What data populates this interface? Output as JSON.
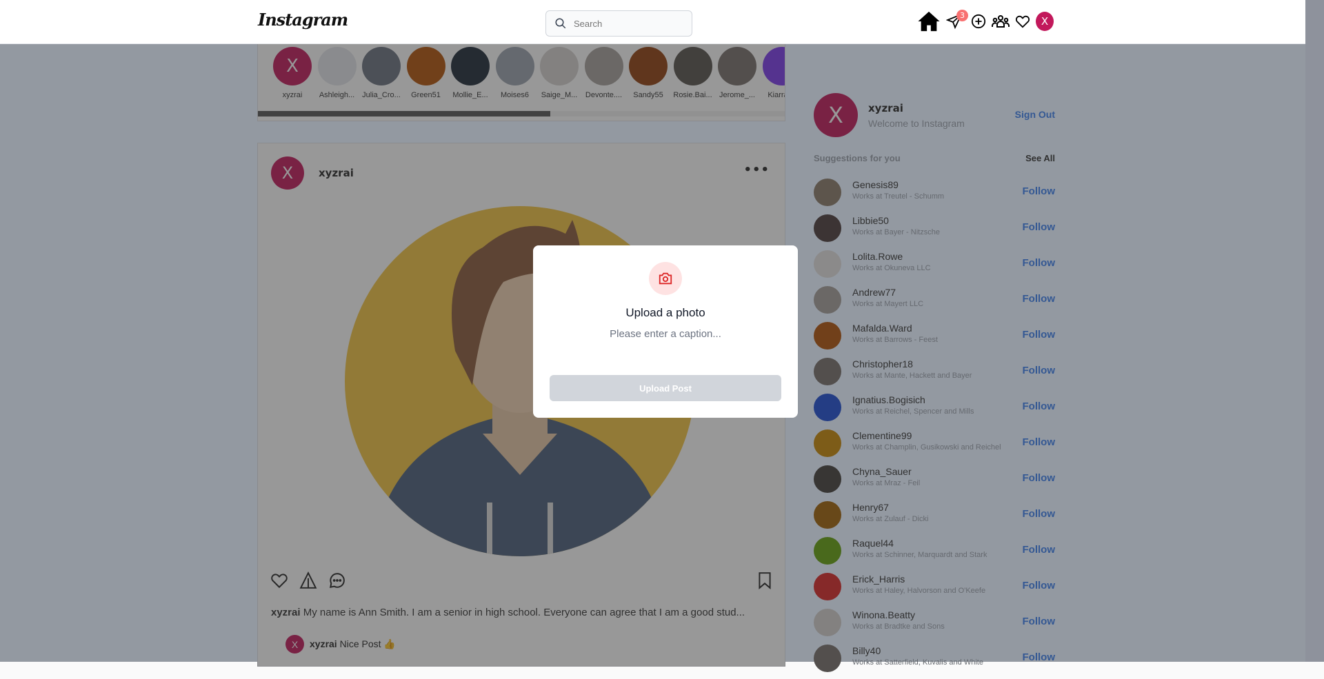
{
  "nav": {
    "logo": "Instagram",
    "search_placeholder": "Search",
    "message_badge": "3",
    "avatar_letter": "X"
  },
  "stories": [
    {
      "name": "xyzrai",
      "letter": "X",
      "color": "#c2185b"
    },
    {
      "name": "Ashleigh...",
      "color": "#e5e7eb"
    },
    {
      "name": "Julia_Cro...",
      "color": "#6b7280"
    },
    {
      "name": "Green51",
      "color": "#b45309"
    },
    {
      "name": "Mollie_E...",
      "color": "#1f2937"
    },
    {
      "name": "Moises6",
      "color": "#9ca3af"
    },
    {
      "name": "Saige_M...",
      "color": "#d6d3d1"
    },
    {
      "name": "Devonte....",
      "color": "#a8a29e"
    },
    {
      "name": "Sandy55",
      "color": "#92400e"
    },
    {
      "name": "Rosie.Bai...",
      "color": "#57534e"
    },
    {
      "name": "Jerome_...",
      "color": "#78716c"
    },
    {
      "name": "Kiarra.C",
      "color": "#7c3aed"
    }
  ],
  "post": {
    "avatar_letter": "X",
    "username": "xyzrai",
    "more": "•••",
    "caption_user": "xyzrai",
    "caption_text": "My name is Ann Smith. I am a senior in high school. Everyone can agree that I am a good stud...",
    "comment": {
      "avatar_letter": "X",
      "user": "xyzrai",
      "text": "Nice Post 👍"
    }
  },
  "profile": {
    "letter": "X",
    "username": "xyzrai",
    "subtitle": "Welcome to Instagram",
    "signout": "Sign Out"
  },
  "suggestions": {
    "title": "Suggestions for you",
    "see_all": "See All",
    "follow_label": "Follow",
    "items": [
      {
        "name": "Genesis89",
        "sub": "Works at Treutel - Schumm",
        "color": "#8b7d6b"
      },
      {
        "name": "Libbie50",
        "sub": "Works at Bayer - Nitzsche",
        "color": "#4b3b3b"
      },
      {
        "name": "Lolita.Rowe",
        "sub": "Works at Okuneva LLC",
        "color": "#e7e5e4"
      },
      {
        "name": "Andrew77",
        "sub": "Works at Mayert LLC",
        "color": "#a8a29e"
      },
      {
        "name": "Mafalda.Ward",
        "sub": "Works at Barrows - Feest",
        "color": "#b45309"
      },
      {
        "name": "Christopher18",
        "sub": "Works at Mante, Hackett and Bayer",
        "color": "#78716c"
      },
      {
        "name": "Ignatius.Bogisich",
        "sub": "Works at Reichel, Spencer and Mills",
        "color": "#1d4ed8"
      },
      {
        "name": "Clementine99",
        "sub": "Works at Champlin, Gusikowski and Reichel",
        "color": "#ca8a04"
      },
      {
        "name": "Chyna_Sauer",
        "sub": "Works at Mraz - Feil",
        "color": "#44403c"
      },
      {
        "name": "Henry67",
        "sub": "Works at Zulauf - Dicki",
        "color": "#a16207"
      },
      {
        "name": "Raquel44",
        "sub": "Works at Schinner, Marquardt and Stark",
        "color": "#65a30d"
      },
      {
        "name": "Erick_Harris",
        "sub": "Works at Haley, Halvorson and O'Keefe",
        "color": "#dc2626"
      },
      {
        "name": "Winona.Beatty",
        "sub": "Works at Bradtke and Sons",
        "color": "#d6d3d1"
      },
      {
        "name": "Billy40",
        "sub": "Works at Satterfield, Kuvalis and White",
        "color": "#78716c"
      }
    ]
  },
  "modal": {
    "title": "Upload a photo",
    "caption_placeholder": "Please enter a caption...",
    "button": "Upload Post"
  }
}
